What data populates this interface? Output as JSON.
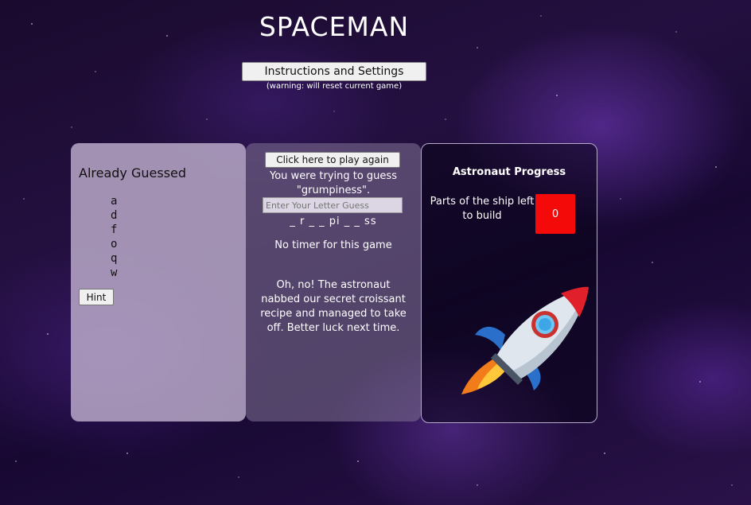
{
  "header": {
    "title": "SPACEMAN",
    "instructions_button": "Instructions and Settings",
    "warning": "(warning: will reset current game)"
  },
  "guessed_panel": {
    "title": "Already Guessed",
    "letters": [
      "a",
      "d",
      "f",
      "o",
      "q",
      "w"
    ],
    "hint_button": "Hint"
  },
  "game_panel": {
    "play_again_button": "Click here to play again",
    "trying_message": "You were trying to guess \"grumpiness\".",
    "letter_input_placeholder": "Enter Your Letter Guess",
    "word_progress": "_ r _ _ pi _ _ ss",
    "timer_text": "No timer for this game",
    "result_message": "Oh, no! The astronaut nabbed our secret croissant recipe and managed to take off. Better luck next time."
  },
  "astronaut_panel": {
    "title": "Astronaut Progress",
    "parts_label": "Parts of the ship left to build",
    "parts_left": "0",
    "rocket_icon": "rocket-icon"
  },
  "colors": {
    "parts_badge": "#f50a0a",
    "background": "#1a0a2e"
  }
}
